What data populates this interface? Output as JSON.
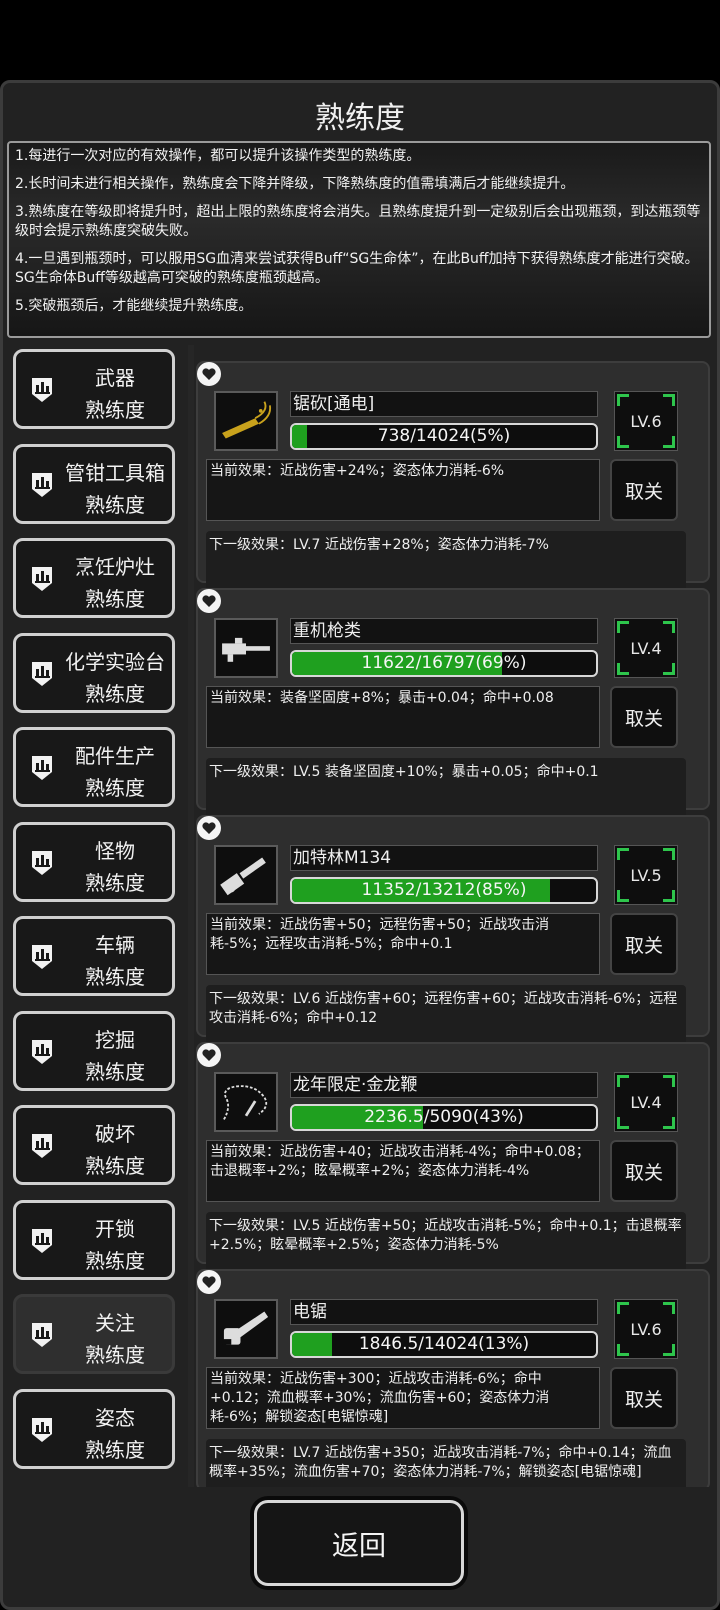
{
  "title": "熟练度",
  "info": [
    "1.每进行一次对应的有效操作，都可以提升该操作类型的熟练度。",
    "2.长时间未进行相关操作，熟练度会下降并降级，下降熟练度的值需填满后才能继续提升。",
    "3.熟练度在等级即将提升时，超出上限的熟练度将会消失。且熟练度提升到一定级别后会出现瓶颈，到达瓶颈等级时会提示熟练度突破失败。",
    "4.一旦遇到瓶颈时，可以服用SG血清来尝试获得Buff“SG生命体”，在此Buff加持下获得熟练度才能进行突破。SG生命体Buff等级越高可突破的熟练度瓶颈越高。",
    "5.突破瓶颈后，才能继续提升熟练度。"
  ],
  "categories": [
    {
      "l1": "武器",
      "l2": "熟练度"
    },
    {
      "l1": "管钳工具箱",
      "l2": "熟练度"
    },
    {
      "l1": "烹饪炉灶",
      "l2": "熟练度"
    },
    {
      "l1": "化学实验台",
      "l2": "熟练度"
    },
    {
      "l1": "配件生产",
      "l2": "熟练度"
    },
    {
      "l1": "怪物",
      "l2": "熟练度"
    },
    {
      "l1": "车辆",
      "l2": "熟练度"
    },
    {
      "l1": "挖掘",
      "l2": "熟练度"
    },
    {
      "l1": "破坏",
      "l2": "熟练度"
    },
    {
      "l1": "开锁",
      "l2": "熟练度"
    },
    {
      "l1": "关注",
      "l2": "熟练度"
    },
    {
      "l1": "姿态",
      "l2": "熟练度"
    }
  ],
  "active_category": "关注",
  "unfollow_label": "取关",
  "items": [
    {
      "name": "锯砍[通电]",
      "progress": "738/14024(5%)",
      "fraction": 0.05,
      "level": "LV.6",
      "icon": "chainsaw-blade-icon",
      "current": "当前效果：近战伤害+24%；姿态体力消耗-6%",
      "next": "下一级效果：LV.7 近战伤害+28%；姿态体力消耗-7%"
    },
    {
      "name": "重机枪类",
      "progress": "11622/16797(69%)",
      "fraction": 0.69,
      "level": "LV.4",
      "icon": "heavy-machine-gun-icon",
      "current": "当前效果：装备坚固度+8%；暴击+0.04；命中+0.08",
      "next": "下一级效果：LV.5 装备坚固度+10%；暴击+0.05；命中+0.1"
    },
    {
      "name": "加特林M134",
      "progress": "11352/13212(85%)",
      "fraction": 0.85,
      "level": "LV.5",
      "icon": "gatling-gun-icon",
      "current": "当前效果：近战伤害+50；远程伤害+50；近战攻击消耗-5%；远程攻击消耗-5%；命中+0.1",
      "next": "下一级效果：LV.6 近战伤害+60；远程伤害+60；近战攻击消耗-6%；远程攻击消耗-6%；命中+0.12"
    },
    {
      "name": "龙年限定·金龙鞭",
      "progress": "2236.5/5090(43%)",
      "fraction": 0.43,
      "level": "LV.4",
      "icon": "chain-whip-icon",
      "current": "当前效果：近战伤害+40；近战攻击消耗-4%；命中+0.08；击退概率+2%；眩晕概率+2%；姿态体力消耗-4%",
      "next": "下一级效果：LV.5 近战伤害+50；近战攻击消耗-5%；命中+0.1；击退概率+2.5%；眩晕概率+2.5%；姿态体力消耗-5%"
    },
    {
      "name": "电锯",
      "progress": "1846.5/14024(13%)",
      "fraction": 0.13,
      "level": "LV.6",
      "icon": "chainsaw-icon",
      "current": "当前效果：近战伤害+300；近战攻击消耗-6%；命中+0.12；流血概率+30%；流血伤害+60；姿态体力消耗-6%；解锁姿态[电锯惊魂]",
      "next": "下一级效果：LV.7 近战伤害+350；近战攻击消耗-7%；命中+0.14；流血概率+35%；流血伤害+70；姿态体力消耗-7%；解锁姿态[电锯惊魂]"
    }
  ],
  "back_label": "返回"
}
